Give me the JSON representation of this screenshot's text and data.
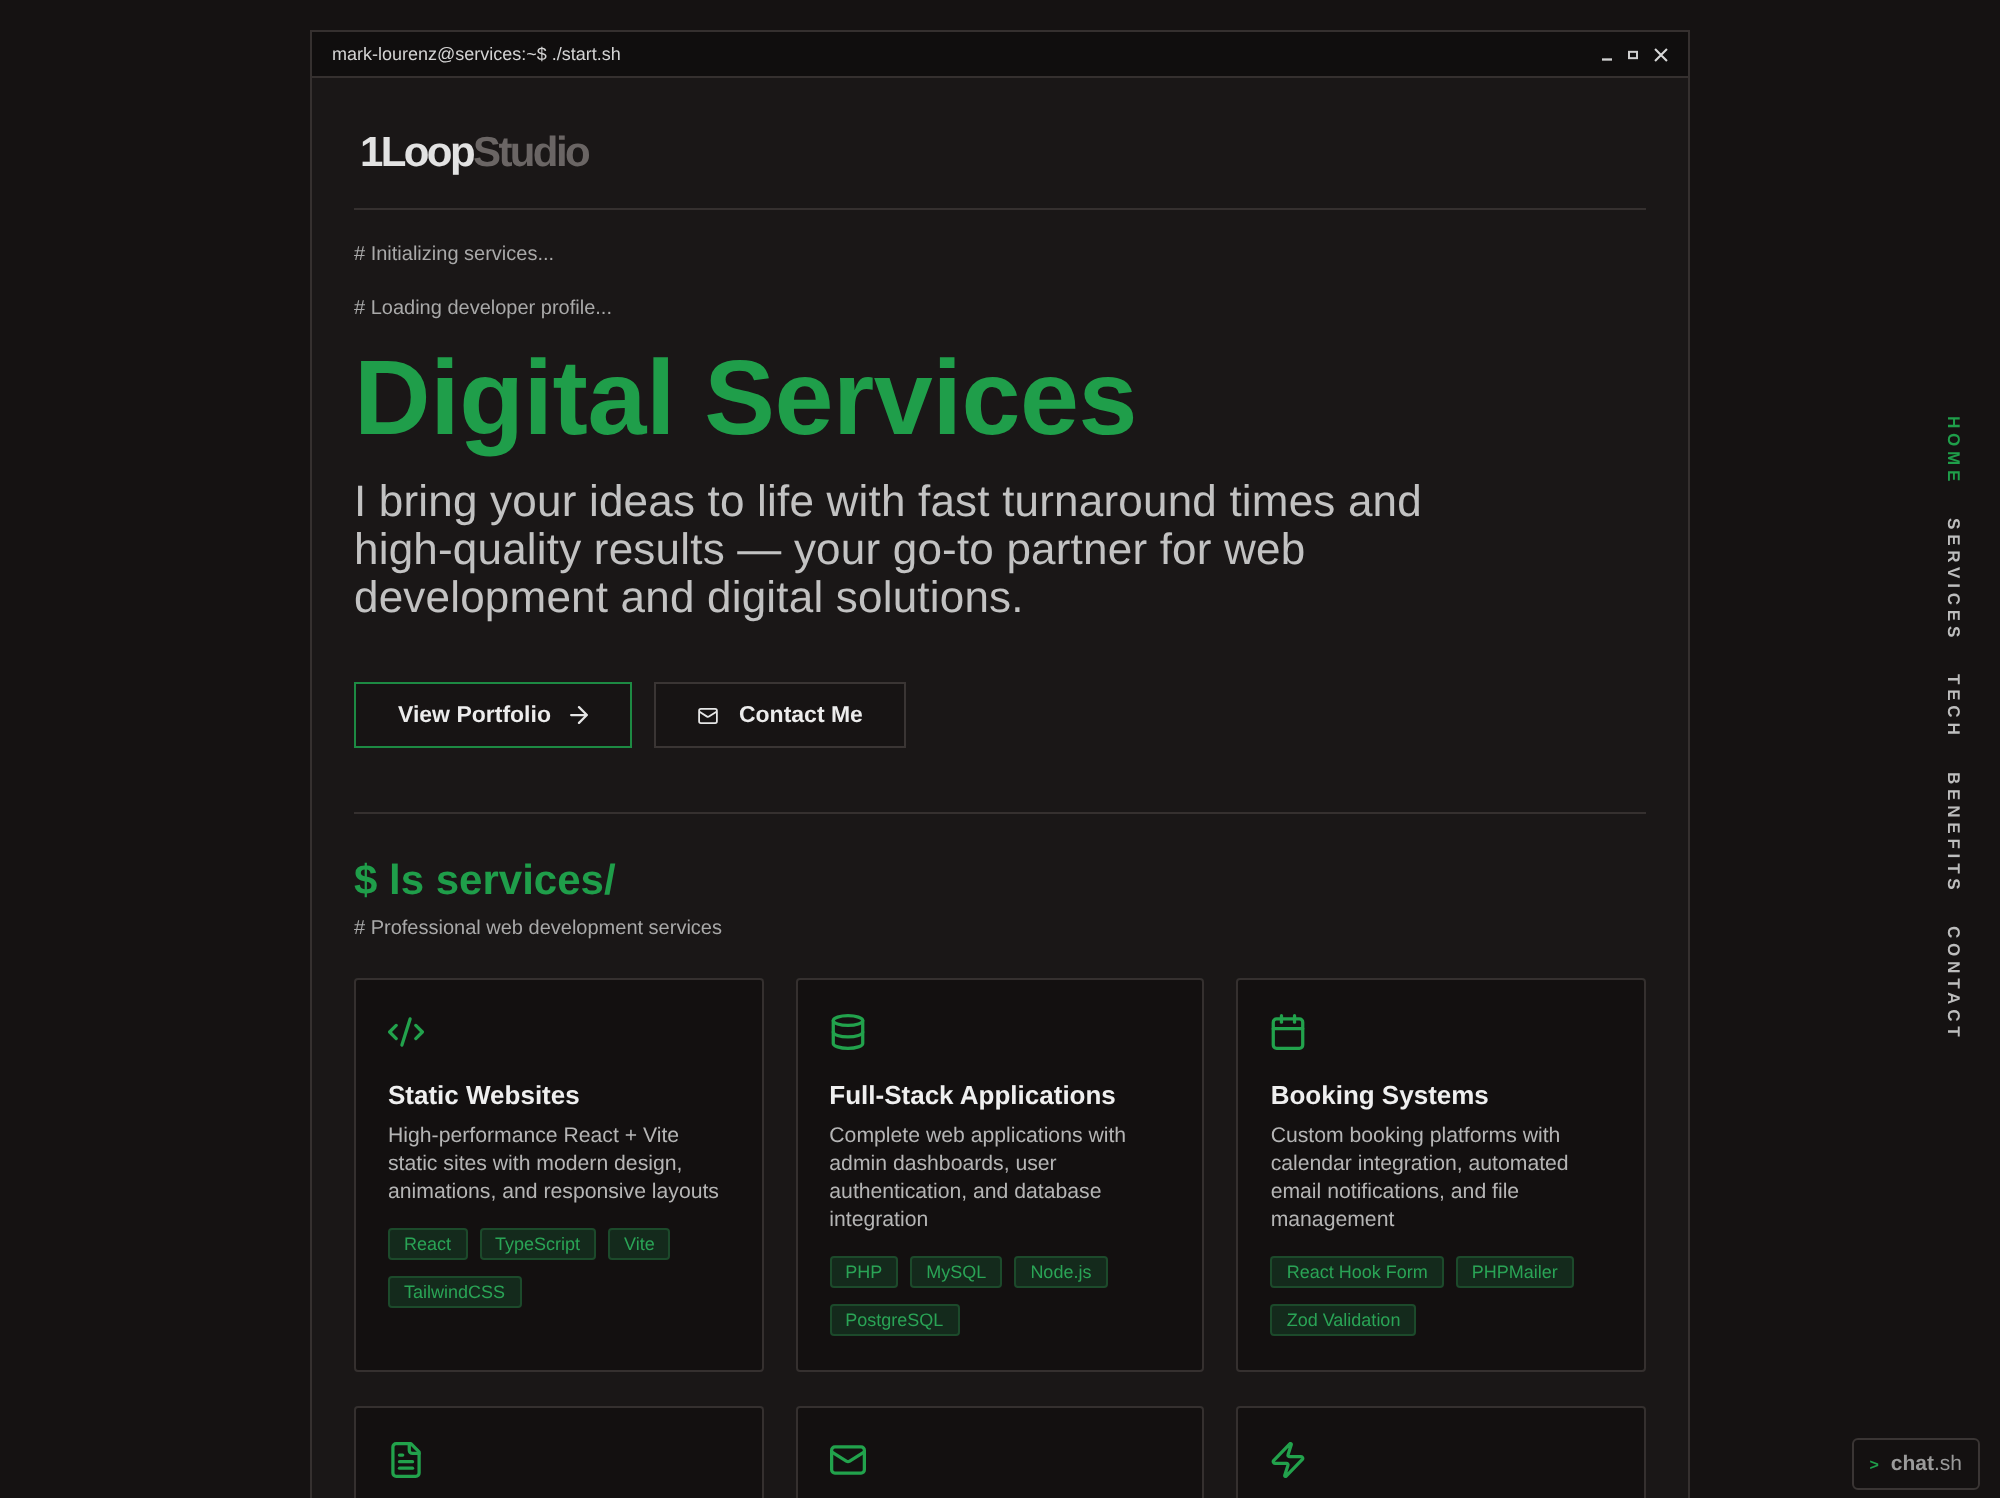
{
  "window": {
    "title": "mark-lourenz@services:~$ ./start.sh"
  },
  "logo": {
    "primary": "1Loop",
    "secondary": "Studio"
  },
  "hero": {
    "boot_lines": [
      "# Initializing services...",
      "# Loading developer profile..."
    ],
    "heading": "Digital Services",
    "description": "I bring your ideas to life with fast turnaround times and high-quality results — your go-to partner for web development and digital solutions.",
    "buttons": [
      {
        "label": "View Portfolio",
        "kind": "primary"
      },
      {
        "label": "Contact Me",
        "kind": "secondary"
      }
    ]
  },
  "services": {
    "command": "$ ls services/",
    "comment": "# Professional web development services",
    "cards": [
      {
        "kind": "code",
        "title": "Static Websites",
        "description": "High-performance React + Vite static sites with modern design, animations, and responsive layouts",
        "tags": [
          "React",
          "TypeScript",
          "Vite",
          "TailwindCSS"
        ]
      },
      {
        "kind": "database",
        "title": "Full-Stack Applications",
        "description": "Complete web applications with admin dashboards, user authentication, and database integration",
        "tags": [
          "PHP",
          "MySQL",
          "Node.js",
          "PostgreSQL"
        ]
      },
      {
        "kind": "calendar",
        "title": "Booking Systems",
        "description": "Custom booking platforms with calendar integration, automated email notifications, and file management",
        "tags": [
          "React Hook Form",
          "PHPMailer",
          "Zod Validation"
        ]
      },
      {
        "kind": "document"
      },
      {
        "kind": "mail"
      },
      {
        "kind": "bolt"
      }
    ]
  },
  "nav": {
    "items": [
      {
        "label": "HOME",
        "selected": true
      },
      {
        "label": "SERVICES",
        "selected": false
      },
      {
        "label": "TECH",
        "selected": false
      },
      {
        "label": "BENEFITS",
        "selected": false
      },
      {
        "label": "CONTACT",
        "selected": false
      }
    ]
  },
  "chat": {
    "prompt": ">",
    "label": "**chat**.sh"
  }
}
